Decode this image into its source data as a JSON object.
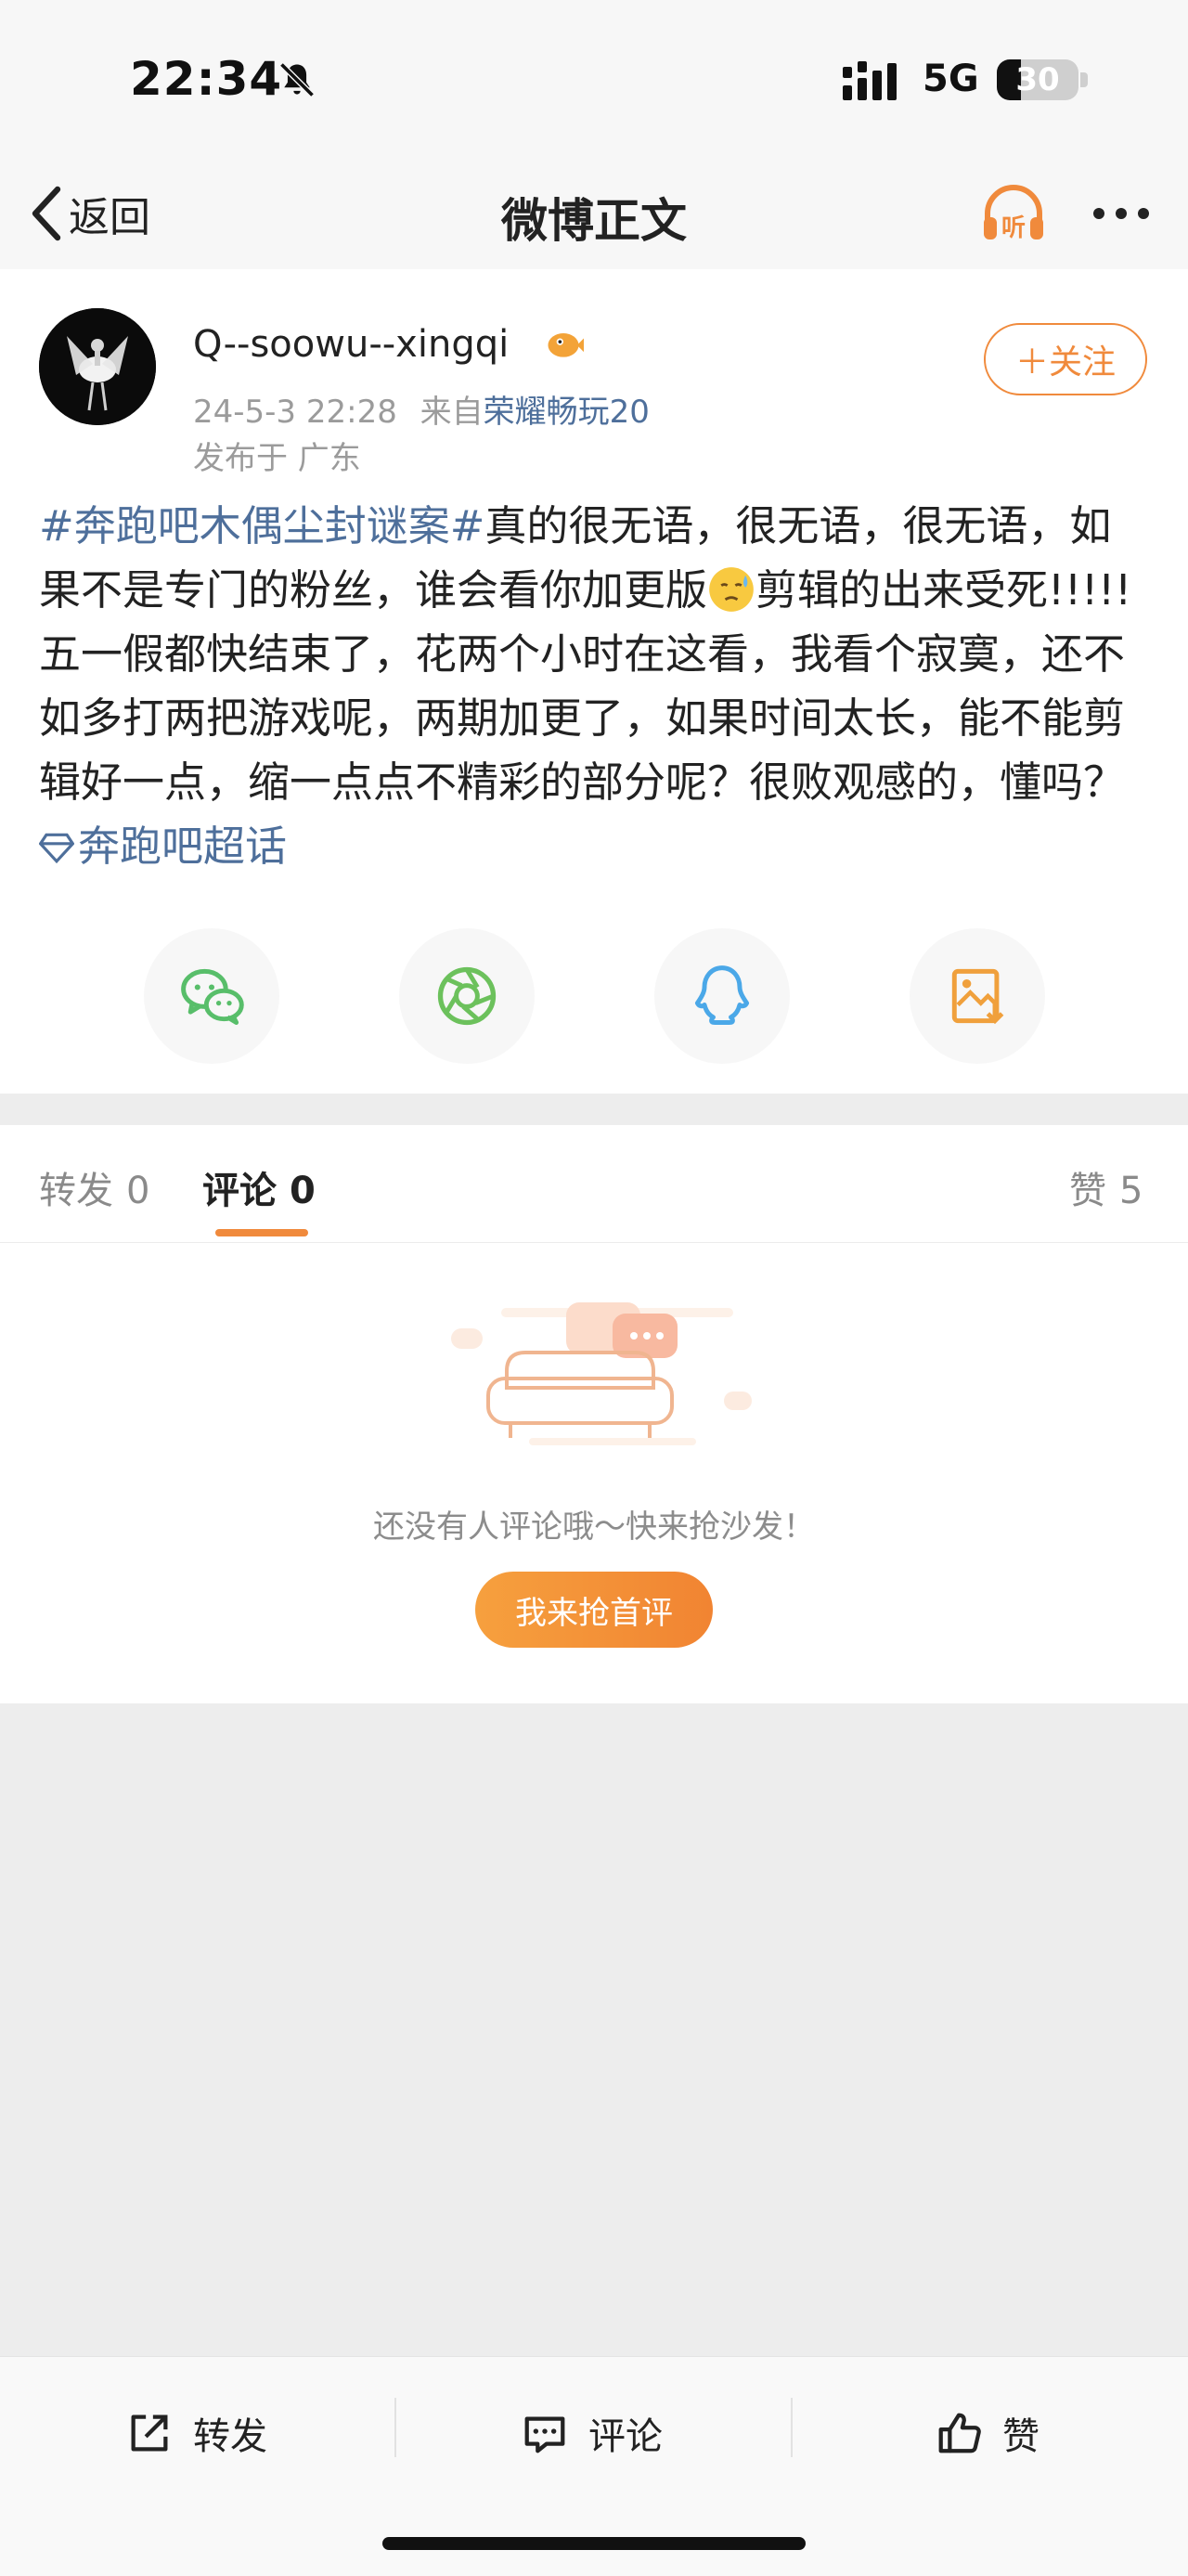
{
  "status_bar": {
    "time": "22:34",
    "network": "5G",
    "battery": "30",
    "battery_level": 0.3,
    "icons": [
      "bell-muted-icon",
      "signal-icon",
      "battery-icon"
    ]
  },
  "nav": {
    "back_label": "返回",
    "title": "微博正文",
    "icons": [
      "chevron-left-icon",
      "headphones-listen-icon",
      "more-icon"
    ],
    "listen_glyph": "听"
  },
  "post": {
    "username": "Q--soowu--xingqi",
    "date": "24-5-3 22:28",
    "from_label": "来自",
    "device": "荣耀畅玩20",
    "location": "发布于 广东",
    "follow_label": "＋关注",
    "topic": "#奔跑吧木偶尘封谜案#",
    "text_part1": "真的很无语，很无语，很无语，如果不是专门的粉丝，谁会看你加更版",
    "text_part2": "剪辑的出来受死!!!!! 五一假都快结束了，花两个小时在这看，我看个寂寞，还不如多打两把游戏呢，两期加更了，如果时间太长，能不能剪辑好一点，缩一点点不精彩的部分呢？很败观感的，懂吗？",
    "super_topic": "奔跑吧超话",
    "emoji": "sweat-face-emoji"
  },
  "share": [
    {
      "name": "wechat",
      "icon": "wechat-icon",
      "color": "#58be6a"
    },
    {
      "name": "moments",
      "icon": "moments-icon",
      "color": "#6cc15c"
    },
    {
      "name": "qq",
      "icon": "qq-icon",
      "color": "#4ba8e8"
    },
    {
      "name": "save-image",
      "icon": "save-image-icon",
      "color": "#f0a03c"
    }
  ],
  "tabs": [
    {
      "label": "转发",
      "count": "0",
      "active": false
    },
    {
      "label": "评论",
      "count": "0",
      "active": true
    },
    {
      "label": "赞",
      "count": "5",
      "active": false
    }
  ],
  "comments": {
    "empty_text": "还没有人评论哦～快来抢沙发！",
    "first_button": "我来抢首评"
  },
  "toolbar": {
    "repost": "转发",
    "comment": "评论",
    "like": "赞"
  },
  "colors": {
    "accent": "#f08a3c",
    "link": "#4e6f9b"
  }
}
